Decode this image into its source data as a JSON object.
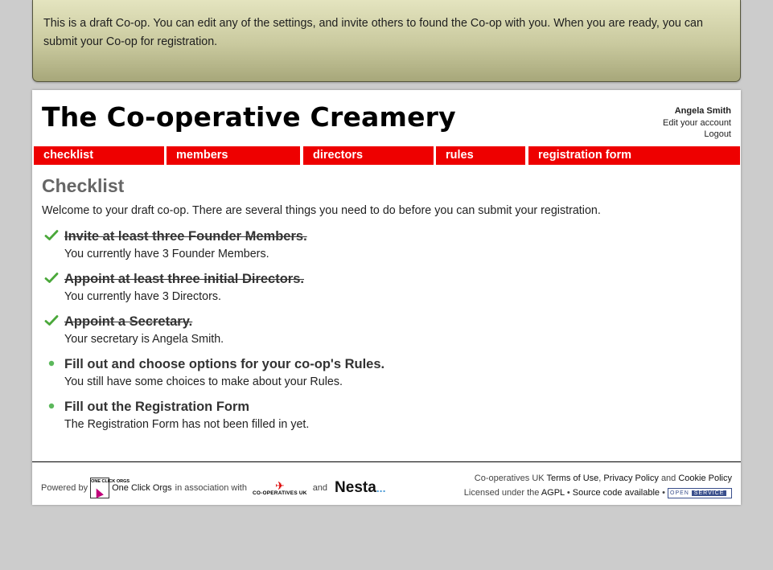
{
  "draft_notice": "This is a draft Co-op. You can edit any of the settings, and invite others to found the Co-op with you. When you are ready, you can submit your Co-op for registration.",
  "site_title": "The Co-operative Creamery",
  "account": {
    "user_name": "Angela Smith",
    "edit_link": "Edit your account",
    "logout_link": "Logout"
  },
  "nav": {
    "tabs": [
      {
        "label": "checklist"
      },
      {
        "label": "members"
      },
      {
        "label": "directors"
      },
      {
        "label": "rules"
      },
      {
        "label": "registration form"
      }
    ],
    "color": "#ee0000"
  },
  "main": {
    "heading": "Checklist",
    "intro": "Welcome to your draft co-op. There are several things you need to do before you can submit your registration.",
    "items": [
      {
        "title": "Invite at least three Founder Members.",
        "status": "You currently have 3 Founder Members.",
        "done": true,
        "icon": "checkmark-icon"
      },
      {
        "title": "Appoint at least three initial Directors.",
        "status": "You currently have 3 Directors.",
        "done": true,
        "icon": "checkmark-icon"
      },
      {
        "title": "Appoint a Secretary.",
        "status": "Your secretary is Angela Smith.",
        "done": true,
        "icon": "checkmark-icon"
      },
      {
        "title": "Fill out and choose options for your co-op's Rules.",
        "status": "You still have some choices to make about your Rules.",
        "done": false,
        "icon": "bullet-icon"
      },
      {
        "title": "Fill out the Registration Form",
        "status": "The Registration Form has not been filled in yet.",
        "done": false,
        "icon": "bullet-icon"
      }
    ]
  },
  "footer": {
    "powered_by": "Powered by",
    "oco_logo_text": "ONE CLICK ORGS",
    "oco_link": "One Click Orgs",
    "association": "in association with",
    "cuk_logo_text": "CO-OPERATIVES UK",
    "and": "and",
    "nesta": "Nesta",
    "nesta_dots": "...",
    "cuk_name": "Co-operatives UK",
    "terms": "Terms of Use",
    "comma": ",",
    "privacy": "Privacy Policy",
    "and2": "and",
    "cookie": "Cookie Policy",
    "license_prefix": "Licensed under the",
    "agpl": "AGPL",
    "bullet": "•",
    "source": "Source code available",
    "badge_open": "OPEN",
    "badge_service": "SERVICE"
  }
}
